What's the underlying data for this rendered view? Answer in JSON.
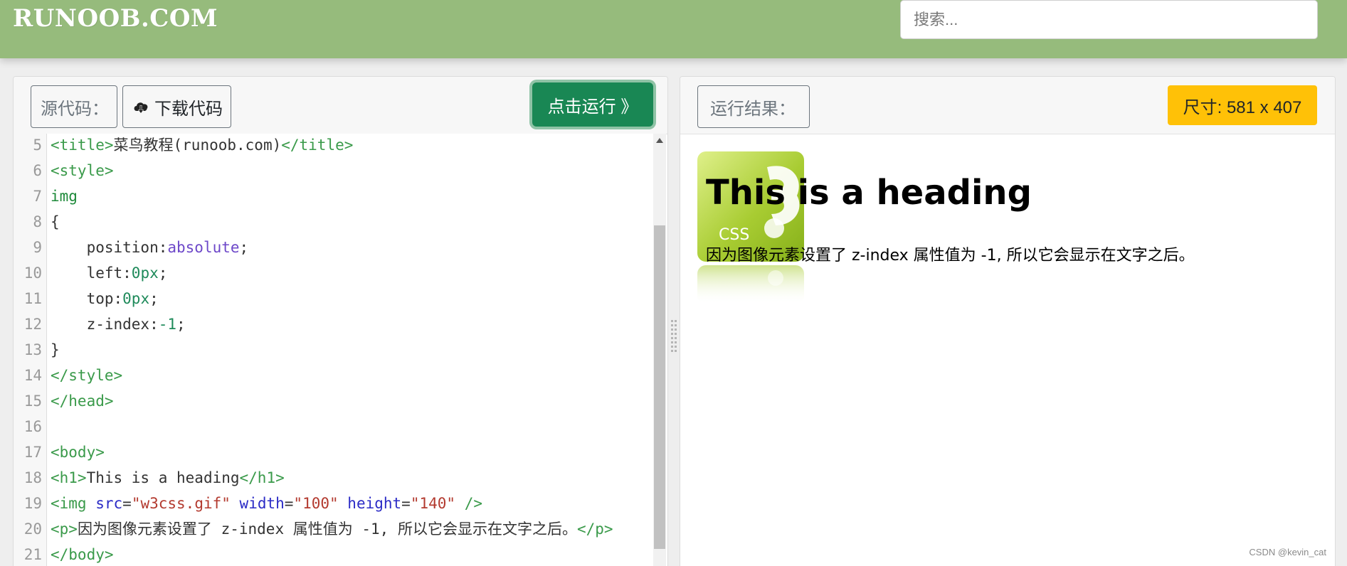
{
  "header": {
    "logo": "RUNOOB.COM",
    "search_placeholder": "搜索..."
  },
  "editor_panel": {
    "source_label": "源代码：",
    "download_label": "下载代码",
    "run_label": "点击运行 》"
  },
  "code_lines": [
    {
      "num": "5",
      "tokens": [
        [
          "tag",
          "<title>"
        ],
        [
          "txt",
          "菜鸟教程(runoob.com)"
        ],
        [
          "tag",
          "</title>"
        ]
      ]
    },
    {
      "num": "6",
      "tokens": [
        [
          "tag",
          "<style>"
        ]
      ]
    },
    {
      "num": "7",
      "tokens": [
        [
          "sel",
          "img"
        ]
      ]
    },
    {
      "num": "8",
      "tokens": [
        [
          "txt",
          "{"
        ]
      ]
    },
    {
      "num": "9",
      "tokens": [
        [
          "txt",
          "    position:"
        ],
        [
          "kw",
          "absolute"
        ],
        [
          "txt",
          ";"
        ]
      ]
    },
    {
      "num": "10",
      "tokens": [
        [
          "txt",
          "    left:"
        ],
        [
          "num",
          "0px"
        ],
        [
          "txt",
          ";"
        ]
      ]
    },
    {
      "num": "11",
      "tokens": [
        [
          "txt",
          "    top:"
        ],
        [
          "num",
          "0px"
        ],
        [
          "txt",
          ";"
        ]
      ]
    },
    {
      "num": "12",
      "tokens": [
        [
          "txt",
          "    z-index:"
        ],
        [
          "num",
          "-1"
        ],
        [
          "txt",
          ";"
        ]
      ]
    },
    {
      "num": "13",
      "tokens": [
        [
          "txt",
          "}"
        ]
      ]
    },
    {
      "num": "14",
      "tokens": [
        [
          "tag",
          "</style>"
        ]
      ]
    },
    {
      "num": "15",
      "tokens": [
        [
          "tag",
          "</head>"
        ]
      ]
    },
    {
      "num": "16",
      "tokens": []
    },
    {
      "num": "17",
      "tokens": [
        [
          "tag",
          "<body>"
        ]
      ]
    },
    {
      "num": "18",
      "tokens": [
        [
          "tag",
          "<h1>"
        ],
        [
          "txt",
          "This is a heading"
        ],
        [
          "tag",
          "</h1>"
        ]
      ]
    },
    {
      "num": "19",
      "tokens": [
        [
          "tag",
          "<img "
        ],
        [
          "attr",
          "src"
        ],
        [
          "txt",
          "="
        ],
        [
          "str",
          "\"w3css.gif\""
        ],
        [
          "txt",
          " "
        ],
        [
          "attr",
          "width"
        ],
        [
          "txt",
          "="
        ],
        [
          "str",
          "\"100\""
        ],
        [
          "txt",
          " "
        ],
        [
          "attr",
          "height"
        ],
        [
          "txt",
          "="
        ],
        [
          "str",
          "\"140\""
        ],
        [
          "txt",
          " "
        ],
        [
          "tag",
          "/>"
        ]
      ]
    },
    {
      "num": "20",
      "tokens": [
        [
          "tag",
          "<p>"
        ],
        [
          "txt",
          "因为图像元素设置了 z-index 属性值为 -1, 所以它会显示在文字之后。"
        ],
        [
          "tag",
          "</p>"
        ]
      ]
    },
    {
      "num": "21",
      "tokens": [
        [
          "tag",
          "</body>"
        ]
      ]
    }
  ],
  "result_panel": {
    "result_label": "运行结果：",
    "size_label": "尺寸: 581 x 407",
    "heading": "This is a heading",
    "paragraph": "因为图像元素设置了 z-index 属性值为 -1, 所以它会显示在文字之后。",
    "image_text": "CSS"
  },
  "watermark": "CSDN @kevin_cat",
  "colors": {
    "header_bg": "#96bb7c",
    "run_button": "#198754",
    "size_badge": "#ffc107",
    "code_tag": "#3a9a4a",
    "code_attr": "#2b2bc6",
    "code_string": "#b33a2f",
    "code_keyword": "#6d48c9"
  }
}
